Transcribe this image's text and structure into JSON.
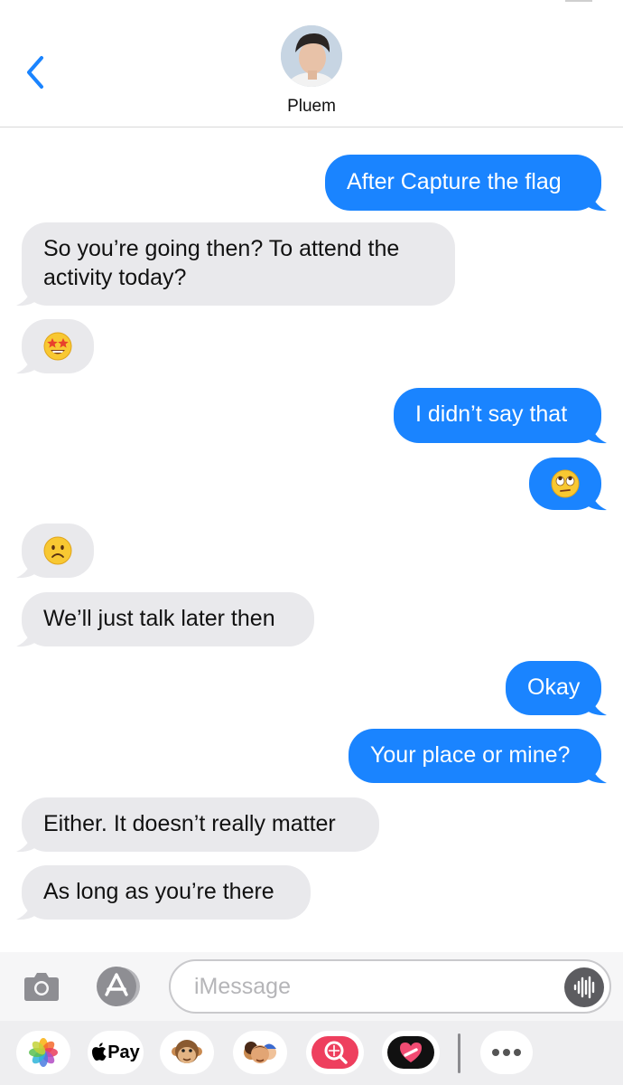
{
  "header": {
    "contact_name": "Pluem"
  },
  "messages": [
    {
      "from": "me",
      "text": "After Capture the flag"
    },
    {
      "from": "them",
      "text": "So you’re going then? To attend the activity today?"
    },
    {
      "from": "them",
      "emoji": "star-struck-face"
    },
    {
      "from": "me",
      "text": "I didn’t say that"
    },
    {
      "from": "me",
      "emoji": "eye-roll-face"
    },
    {
      "from": "them",
      "emoji": "frowning-face"
    },
    {
      "from": "them",
      "text": "We’ll just talk later then"
    },
    {
      "from": "me",
      "text": "Okay"
    },
    {
      "from": "me",
      "text": "Your place or mine?"
    },
    {
      "from": "them",
      "text": "Either. It doesn’t really matter"
    },
    {
      "from": "them",
      "text": "As long as you’re there"
    }
  ],
  "composer": {
    "placeholder": "iMessage"
  },
  "app_tray": {
    "apple_pay_label": "Pay",
    "apps": [
      "photos-icon",
      "apple-pay-icon",
      "monkey-animoji-icon",
      "memoji-stickers-icon",
      "image-search-icon",
      "digital-touch-icon",
      "more-icon"
    ]
  },
  "colors": {
    "outgoing": "#1a84ff",
    "incoming": "#e9e9ec",
    "accent": "#1a84ff"
  }
}
